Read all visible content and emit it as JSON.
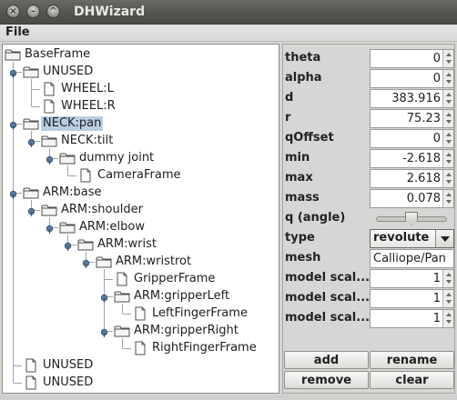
{
  "window": {
    "title": "DHWizard"
  },
  "menu": {
    "file": "File"
  },
  "tree": {
    "nodes": [
      {
        "label": "BaseFrame",
        "depth": 0,
        "type": "folder",
        "expander": false,
        "selected": false
      },
      {
        "label": "UNUSED",
        "depth": 1,
        "type": "folder",
        "expander": true,
        "selected": false
      },
      {
        "label": "WHEEL:L",
        "depth": 2,
        "type": "file",
        "expander": false,
        "selected": false
      },
      {
        "label": "WHEEL:R",
        "depth": 2,
        "type": "file",
        "expander": false,
        "selected": false
      },
      {
        "label": "NECK:pan",
        "depth": 1,
        "type": "folder",
        "expander": true,
        "selected": true
      },
      {
        "label": "NECK:tilt",
        "depth": 2,
        "type": "folder",
        "expander": true,
        "selected": false
      },
      {
        "label": "dummy joint",
        "depth": 3,
        "type": "folder",
        "expander": true,
        "selected": false
      },
      {
        "label": "CameraFrame",
        "depth": 4,
        "type": "file",
        "expander": false,
        "selected": false
      },
      {
        "label": "ARM:base",
        "depth": 1,
        "type": "folder",
        "expander": true,
        "selected": false
      },
      {
        "label": "ARM:shoulder",
        "depth": 2,
        "type": "folder",
        "expander": true,
        "selected": false
      },
      {
        "label": "ARM:elbow",
        "depth": 3,
        "type": "folder",
        "expander": true,
        "selected": false
      },
      {
        "label": "ARM:wrist",
        "depth": 4,
        "type": "folder",
        "expander": true,
        "selected": false
      },
      {
        "label": "ARM:wristrot",
        "depth": 5,
        "type": "folder",
        "expander": true,
        "selected": false
      },
      {
        "label": "GripperFrame",
        "depth": 6,
        "type": "file",
        "expander": false,
        "selected": false
      },
      {
        "label": "ARM:gripperLeft",
        "depth": 6,
        "type": "folder",
        "expander": true,
        "selected": false
      },
      {
        "label": "LeftFingerFrame",
        "depth": 7,
        "type": "file",
        "expander": false,
        "selected": false
      },
      {
        "label": "ARM:gripperRight",
        "depth": 6,
        "type": "folder",
        "expander": true,
        "selected": false
      },
      {
        "label": "RightFingerFrame",
        "depth": 7,
        "type": "file",
        "expander": false,
        "selected": false
      },
      {
        "label": "UNUSED",
        "depth": 1,
        "type": "file",
        "expander": false,
        "selected": false
      },
      {
        "label": "UNUSED",
        "depth": 1,
        "type": "file",
        "expander": false,
        "selected": false
      }
    ]
  },
  "props": {
    "theta": {
      "label": "theta",
      "value": "0"
    },
    "alpha": {
      "label": "alpha",
      "value": "0"
    },
    "d": {
      "label": "d",
      "value": "383.916"
    },
    "r": {
      "label": "r",
      "value": "75.23"
    },
    "qOffset": {
      "label": "qOffset",
      "value": "0"
    },
    "min": {
      "label": "min",
      "value": "-2.618"
    },
    "max": {
      "label": "max",
      "value": "2.618"
    },
    "mass": {
      "label": "mass",
      "value": "0.078"
    },
    "q": {
      "label": "q (angle)",
      "fraction": 0.5
    },
    "type": {
      "label": "type",
      "value": "revolute"
    },
    "mesh": {
      "label": "mesh",
      "value": "Calliope/Pan"
    },
    "scale1": {
      "label": "model scal...",
      "value": "1"
    },
    "scale2": {
      "label": "model scal...",
      "value": "1"
    },
    "scale3": {
      "label": "model scal...",
      "value": "1"
    }
  },
  "buttons": {
    "add": "add",
    "rename": "rename",
    "remove": "remove",
    "clear": "clear"
  },
  "icons": {
    "close": "close-icon",
    "minimize": "minimize-icon",
    "maximize": "maximize-icon",
    "folder": "folder-icon",
    "file": "file-icon",
    "expander": "tree-expander-icon"
  },
  "colors": {
    "selection": "#b9cde3",
    "titlebar": "#545450",
    "panel": "#d6d6d4"
  }
}
